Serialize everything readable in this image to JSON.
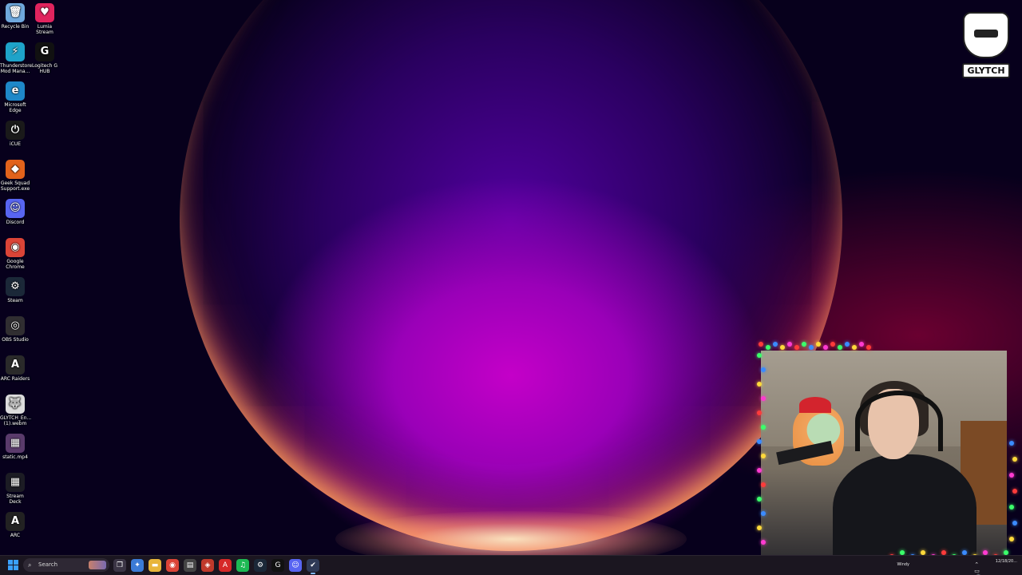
{
  "desktop": {
    "icons": [
      {
        "label": "Recycle Bin",
        "icon": "recycle-bin-icon",
        "color": "#6fa8dc",
        "glyph": "🗑"
      },
      {
        "label": "Lumia Stream",
        "icon": "lumia-stream-icon",
        "color": "#e0245e",
        "glyph": "♥"
      },
      {
        "label": "Thunderstore Mod Mana...",
        "icon": "thunderstore-icon",
        "color": "#1ea3c9",
        "glyph": "⚡"
      },
      {
        "label": "Logitech G HUB",
        "icon": "logitech-g-hub-icon",
        "color": "#111111",
        "glyph": "G"
      },
      {
        "label": "Microsoft Edge",
        "icon": "edge-icon",
        "color": "#1e88c8",
        "glyph": "e"
      },
      {
        "label": "iCUE",
        "icon": "icue-icon",
        "color": "#1a1a1a",
        "glyph": "⏻"
      },
      {
        "label": "Geek Squad Support.exe",
        "icon": "geek-squad-icon",
        "color": "#e2621b",
        "glyph": "◆"
      },
      {
        "label": "Discord",
        "icon": "discord-icon",
        "color": "#5865f2",
        "glyph": "☺"
      },
      {
        "label": "Google Chrome",
        "icon": "chrome-icon",
        "color": "#db4437",
        "glyph": "◉"
      },
      {
        "label": "Steam",
        "icon": "steam-icon",
        "color": "#1b2838",
        "glyph": "⚙"
      },
      {
        "label": "OBS Studio",
        "icon": "obs-studio-icon",
        "color": "#302e31",
        "glyph": "◎"
      },
      {
        "label": "ARC Raiders",
        "icon": "arc-raiders-icon",
        "color": "#2a2a2a",
        "glyph": "A"
      },
      {
        "label": "GLYTCH_En... (1).webm",
        "icon": "webm-file-icon",
        "color": "#dddddd",
        "glyph": "🐺"
      },
      {
        "label": "static.mp4",
        "icon": "mp4-file-icon",
        "color": "#5a3b6b",
        "glyph": "▦"
      },
      {
        "label": "Stream Deck",
        "icon": "stream-deck-icon",
        "color": "#1c1c24",
        "glyph": "▦"
      },
      {
        "label": "ARC",
        "icon": "arc-icon",
        "color": "#222222",
        "glyph": "A"
      }
    ]
  },
  "brand": {
    "word": "GLYTCH"
  },
  "taskbar": {
    "search_placeholder": "Search",
    "apps": [
      {
        "name": "task-view-icon",
        "color": "#3b3545",
        "glyph": "❐"
      },
      {
        "name": "copilot-icon",
        "color": "#3b7bd6",
        "glyph": "✦"
      },
      {
        "name": "file-explorer-icon",
        "color": "#e8b53a",
        "glyph": "▬"
      },
      {
        "name": "chrome-taskbar-icon",
        "color": "#db4437",
        "glyph": "◉"
      },
      {
        "name": "app-taskbar-icon",
        "color": "#444444",
        "glyph": "▤"
      },
      {
        "name": "app-red-taskbar-icon",
        "color": "#c0392b",
        "glyph": "◈"
      },
      {
        "name": "adobe-taskbar-icon",
        "color": "#d62828",
        "glyph": "A"
      },
      {
        "name": "spotify-taskbar-icon",
        "color": "#1db954",
        "glyph": "♫"
      },
      {
        "name": "steam-taskbar-icon",
        "color": "#1b2838",
        "glyph": "⚙"
      },
      {
        "name": "logitech-taskbar-icon",
        "color": "#111111",
        "glyph": "G"
      },
      {
        "name": "discord-taskbar-icon",
        "color": "#5865f2",
        "glyph": "☺"
      },
      {
        "name": "active-app-taskbar-icon",
        "color": "#2f3a57",
        "glyph": "✔"
      }
    ],
    "tray": {
      "weather": "Windy",
      "time": "",
      "date": "12/18/20..."
    }
  }
}
